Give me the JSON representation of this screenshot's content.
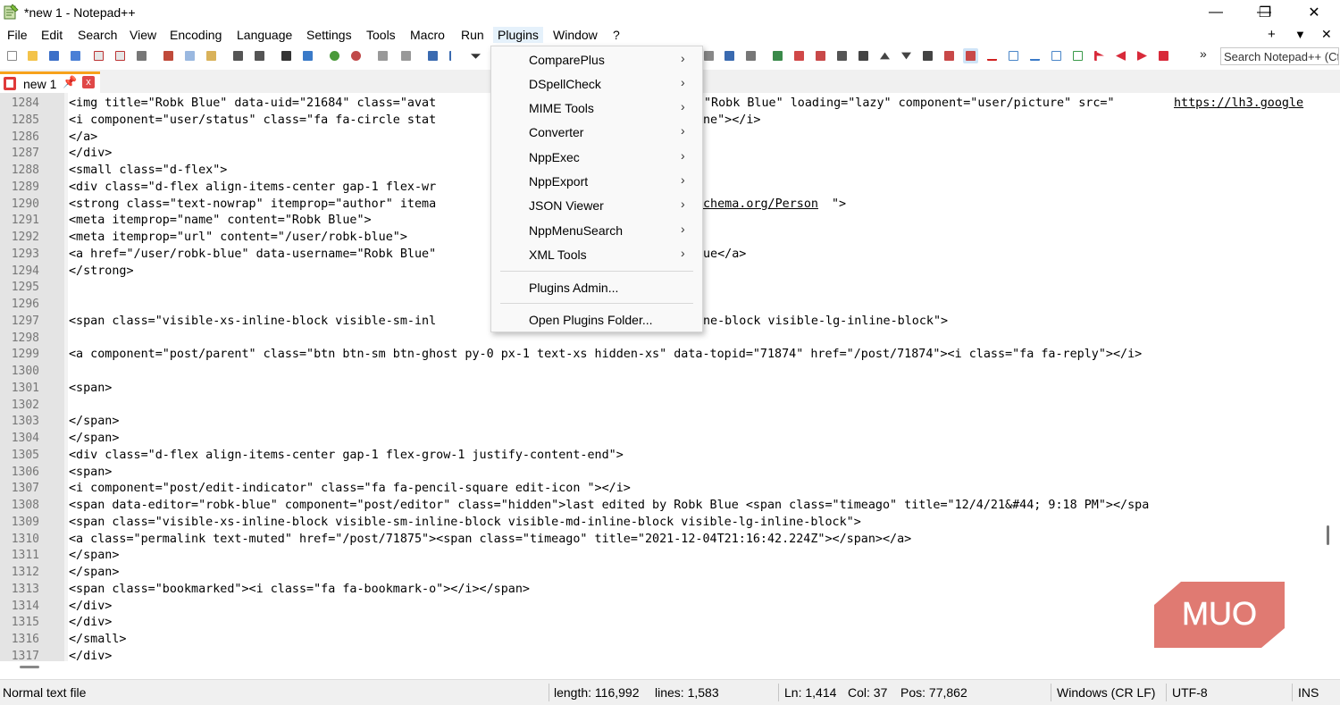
{
  "window": {
    "title": "*new 1 - Notepad++",
    "controls": {
      "minimize": "—",
      "restore": "❐",
      "close": "✕"
    }
  },
  "menubar": {
    "items": [
      "File",
      "Edit",
      "Search",
      "View",
      "Encoding",
      "Language",
      "Settings",
      "Tools",
      "Macro",
      "Run",
      "Plugins",
      "Window",
      "?"
    ],
    "right": {
      "plus": "+",
      "down": "▼",
      "close": "✕"
    }
  },
  "toolbar": {
    "search_placeholder": "Search Notepad++ (Ct",
    "overflow": "»"
  },
  "tab": {
    "label": "new 1",
    "close": "x"
  },
  "plugins_menu": {
    "items": [
      "ComparePlus",
      "DSpellCheck",
      "MIME Tools",
      "Converter",
      "NppExec",
      "NppExport",
      "JSON Viewer",
      "NppMenuSearch",
      "XML Tools"
    ],
    "admin": "Plugins Admin...",
    "open_folder": "Open Plugins Folder...",
    "arrow": "›"
  },
  "editor": {
    "lines": [
      {
        "n": "1284",
        "t": "<img title=\"Robk Blue\" data-uid=\"21684\" class=\"avat"
      },
      {
        "n": "1285",
        "t": "<i component=\"user/status\" class=\"fa fa-circle stat"
      },
      {
        "n": "1286",
        "t": "</a>"
      },
      {
        "n": "1287",
        "t": "</div>"
      },
      {
        "n": "1288",
        "t": "<small class=\"d-flex\">"
      },
      {
        "n": "1289",
        "t": "<div class=\"d-flex align-items-center gap-1 flex-wr"
      },
      {
        "n": "1290",
        "t": "<strong class=\"text-nowrap\" itemprop=\"author\" itema"
      },
      {
        "n": "1291",
        "t": "<meta itemprop=\"name\" content=\"Robk Blue\">"
      },
      {
        "n": "1292",
        "t": "<meta itemprop=\"url\" content=\"/user/robk-blue\">"
      },
      {
        "n": "1293",
        "t": "<a href=\"/user/robk-blue\" data-username=\"Robk Blue\""
      },
      {
        "n": "1294",
        "t": "</strong>"
      },
      {
        "n": "1295",
        "t": ""
      },
      {
        "n": "1296",
        "t": ""
      },
      {
        "n": "1297",
        "t": "<span class=\"visible-xs-inline-block visible-sm-inl"
      },
      {
        "n": "1298",
        "t": ""
      },
      {
        "n": "1299",
        "t": "<a component=\"post/parent\" class=\"btn btn-sm btn-ghost py-0 px-1 text-xs hidden-xs\" data-topid=\"71874\" href=\"/post/71874\"><i class=\"fa fa-reply\"></i>"
      },
      {
        "n": "1300",
        "t": ""
      },
      {
        "n": "1301",
        "t": "<span>"
      },
      {
        "n": "1302",
        "t": ""
      },
      {
        "n": "1303",
        "t": "</span>"
      },
      {
        "n": "1304",
        "t": "</span>"
      },
      {
        "n": "1305",
        "t": "<div class=\"d-flex align-items-center gap-1 flex-grow-1 justify-content-end\">"
      },
      {
        "n": "1306",
        "t": "<span>"
      },
      {
        "n": "1307",
        "t": "<i component=\"post/edit-indicator\" class=\"fa fa-pencil-square edit-icon \"></i>"
      },
      {
        "n": "1308",
        "t": "<span data-editor=\"robk-blue\" component=\"post/editor\" class=\"hidden\">last edited by Robk Blue <span class=\"timeago\" title=\"12/4/21&#44; 9:18 PM\"></spa"
      },
      {
        "n": "1309",
        "t": "<span class=\"visible-xs-inline-block visible-sm-inline-block visible-md-inline-block visible-lg-inline-block\">"
      },
      {
        "n": "1310",
        "t": "<a class=\"permalink text-muted\" href=\"/post/71875\"><span class=\"timeago\" title=\"2021-12-04T21:16:42.224Z\"></span></a>"
      },
      {
        "n": "1311",
        "t": "</span>"
      },
      {
        "n": "1312",
        "t": "</span>"
      },
      {
        "n": "1313",
        "t": "<span class=\"bookmarked\"><i class=\"fa fa-bookmark-o\"></i></span>"
      },
      {
        "n": "1314",
        "t": "</div>"
      },
      {
        "n": "1315",
        "t": "</div>"
      },
      {
        "n": "1316",
        "t": "</small>"
      },
      {
        "n": "1317",
        "t": "</div>"
      }
    ],
    "right_fragments": {
      "r1284_a": "\"Robk Blue\" loading=\"lazy\" component=\"user/picture\" src=\"",
      "r1284_link": "https://lh3.google",
      "r1285": "ne\"></i>",
      "r1290_link": "chema.org/Person",
      "r1290_end": "\">",
      "r1293": "ue</a>",
      "r1297": "ne-block visible-lg-inline-block\">"
    }
  },
  "statusbar": {
    "file_type": "Normal text file",
    "length": "length: 116,992",
    "lines": "lines: 1,583",
    "ln": "Ln: 1,414",
    "col": "Col: 37",
    "pos": "Pos: 77,862",
    "eol": "Windows (CR LF)",
    "encoding": "UTF-8",
    "mode": "INS"
  },
  "watermark": {
    "text": "MUO",
    "color": "#e07a72"
  },
  "colors": {
    "menu_highlight": "#e5f1fb",
    "tab_accent": "#f7a21b",
    "gutter": "#e4e4e4"
  }
}
